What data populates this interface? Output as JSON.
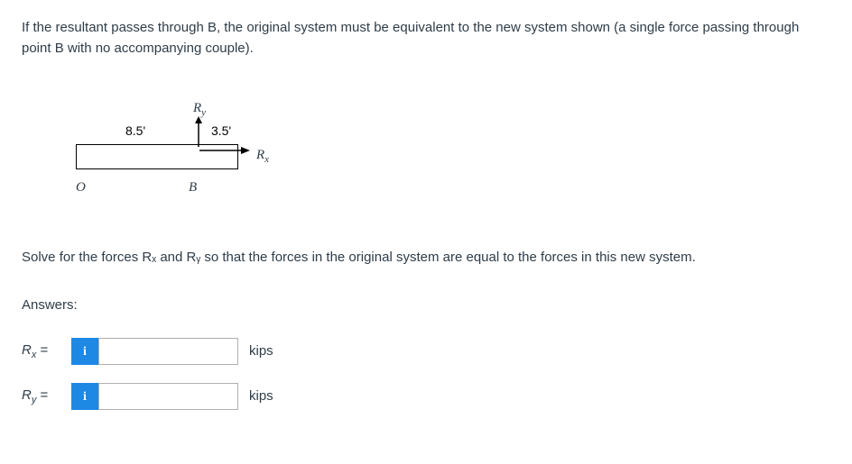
{
  "intro_text": "If the resultant passes through B, the original system must be equivalent to the new system shown (a single force passing through point B with no accompanying couple).",
  "diagram": {
    "point_O": "O",
    "point_B": "B",
    "dim_left": "8.5'",
    "dim_right": "3.5'",
    "force_Ry": "R",
    "force_Ry_sub": "y",
    "force_Rx": "R",
    "force_Rx_sub": "x"
  },
  "solve_text": "Solve for the forces Rₓ and Rᵧ so that the forces in the original system are equal to the forces in this new system.",
  "answers_label": "Answers:",
  "rows": [
    {
      "var_main": "R",
      "var_sub": "x",
      "equals": " = ",
      "info": "i",
      "value": "",
      "unit": "kips"
    },
    {
      "var_main": "R",
      "var_sub": "y",
      "equals": " = ",
      "info": "i",
      "value": "",
      "unit": "kips"
    }
  ]
}
